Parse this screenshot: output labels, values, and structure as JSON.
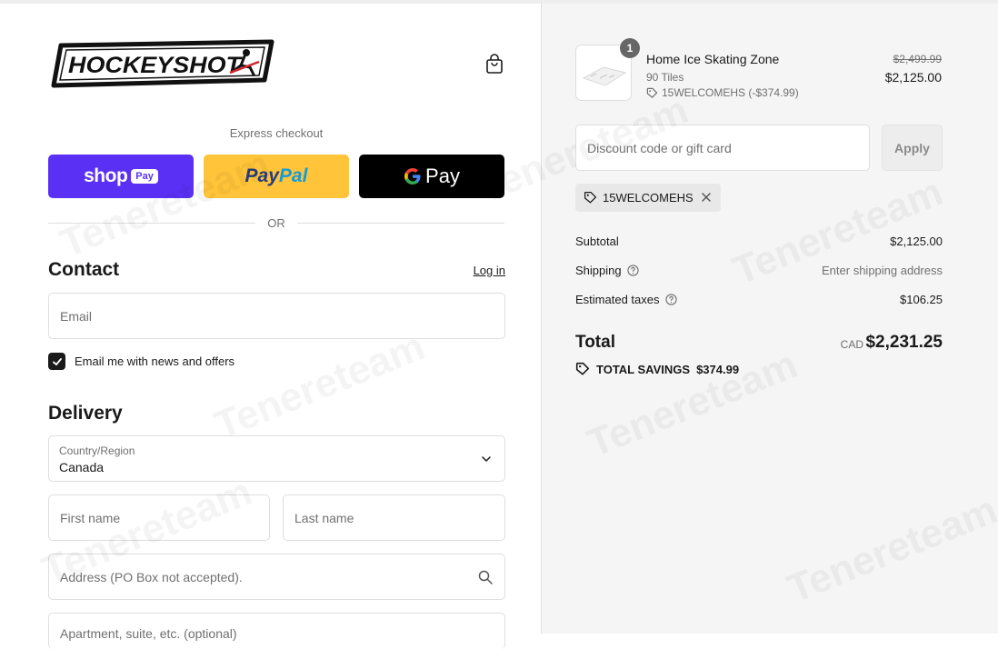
{
  "brand": {
    "logo_text": "HOCKEYSHOT"
  },
  "express": {
    "label": "Express checkout",
    "shop_label": "shop",
    "shop_badge": "Pay",
    "paypal_part1": "Pay",
    "paypal_part2": "Pal",
    "gpay_label": "Pay"
  },
  "or_label": "OR",
  "contact": {
    "title": "Contact",
    "login_label": "Log in",
    "email_placeholder": "Email",
    "news_label": "Email me with news and offers",
    "news_checked": true
  },
  "delivery": {
    "title": "Delivery",
    "country_label": "Country/Region",
    "country_value": "Canada",
    "first_name_placeholder": "First name",
    "last_name_placeholder": "Last name",
    "address_placeholder": "Address (PO Box not accepted).",
    "apartment_placeholder": "Apartment, suite, etc. (optional)"
  },
  "order": {
    "quantity": "1",
    "product_name": "Home Ice Skating Zone",
    "variant": "90 Tiles",
    "discount_line": "15WELCOMEHS (-$374.99)",
    "original_price": "$2,499.99",
    "price": "$2,125.00"
  },
  "discount": {
    "placeholder": "Discount code or gift card",
    "apply_label": "Apply",
    "applied_code": "15WELCOMEHS"
  },
  "summary": {
    "subtotal_label": "Subtotal",
    "subtotal_value": "$2,125.00",
    "shipping_label": "Shipping",
    "shipping_value": "Enter shipping address",
    "taxes_label": "Estimated taxes",
    "taxes_value": "$106.25",
    "total_label": "Total",
    "currency": "CAD",
    "total_value": "$2,231.25",
    "savings_label": "TOTAL SAVINGS",
    "savings_value": "$374.99"
  },
  "watermark": "Tenereteam",
  "colors": {
    "shop_pay": "#5a31f4",
    "paypal": "#ffc439",
    "gpay": "#000000",
    "summary_bg": "#f5f5f5"
  }
}
